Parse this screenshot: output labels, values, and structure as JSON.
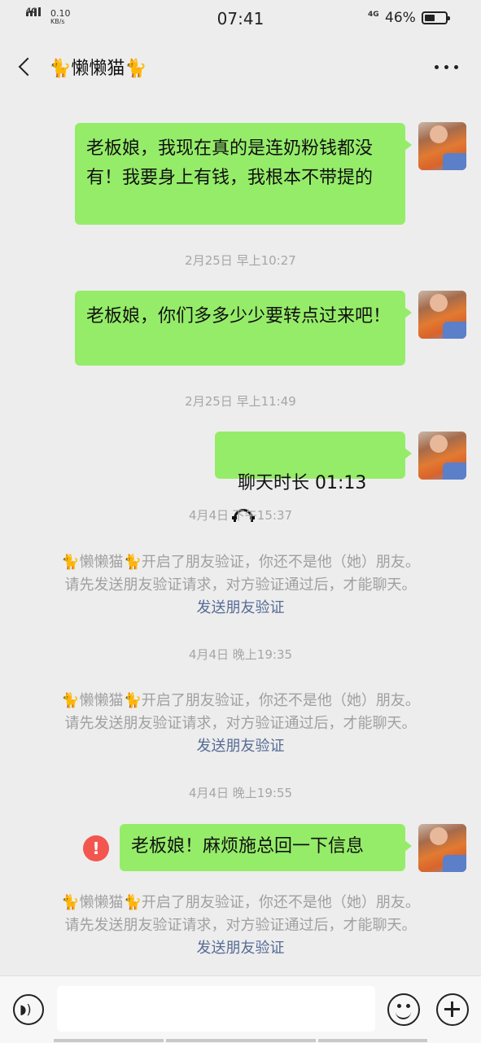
{
  "status": {
    "network": "4G",
    "speed_value": "0.10",
    "speed_unit": "KB/s",
    "time": "07:41",
    "network2": "4G",
    "battery": "46%"
  },
  "header": {
    "title": "🐈懒懒猫🐈"
  },
  "messages": [
    {
      "text": "老板娘，我现在真的是连奶粉钱都没有！我要身上有钱，我根本不带提的"
    },
    {
      "text": "老板娘，你们多多少少要转点过来吧！"
    },
    {
      "text": "聊天时长 01:13"
    },
    {
      "text": "老板娘！麻烦施总回一下信息",
      "failed": true
    }
  ],
  "times": [
    "2月25日 早上10:27",
    "2月25日 早上11:49",
    "4月4日 下午15:37",
    "4月4日 晚上19:35",
    "4月4日 晚上19:55"
  ],
  "system": {
    "line1": "🐈懒懒猫🐈开启了朋友验证，你还不是他（她）朋友。",
    "line2": "请先发送朋友验证请求，对方验证通过后，才能聊天。",
    "link": "发送朋友验证"
  },
  "colors": {
    "bubble": "#95ec69",
    "link": "#576b95",
    "error": "#f2564f",
    "background": "#ededed"
  },
  "icons": [
    "back-arrow-icon",
    "more-icon",
    "hangup-phone-icon",
    "error-icon",
    "voice-icon",
    "emoji-icon",
    "plus-icon"
  ]
}
